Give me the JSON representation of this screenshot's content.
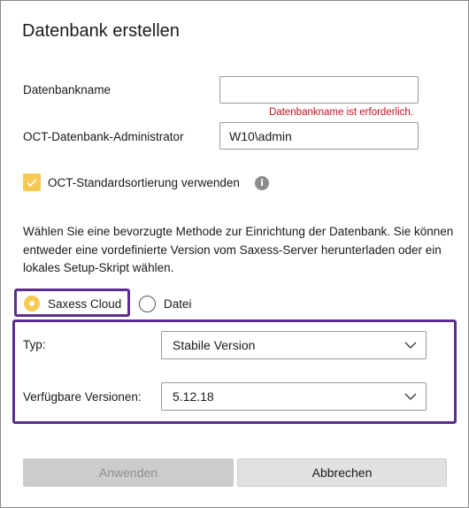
{
  "dialog": {
    "title": "Datenbank erstellen"
  },
  "form": {
    "db_name_label": "Datenbankname",
    "db_name_value": "",
    "db_name_error": "Datenbankname ist erforderlich.",
    "admin_label": "OCT-Datenbank-Administrator",
    "admin_value": "W10\\admin",
    "sort_checkbox_label": "OCT-Standardsortierung verwenden",
    "sort_checkbox_checked": true,
    "info_icon_glyph": "i"
  },
  "description": "Wählen Sie eine bevorzugte Methode zur Einrichtung der Datenbank. Sie können entweder eine vordefinierte Version vom Saxess-Server herunterladen oder ein lokales Setup-Skript wählen.",
  "method": {
    "options": [
      {
        "label": "Saxess Cloud",
        "selected": true
      },
      {
        "label": "Datei",
        "selected": false
      }
    ]
  },
  "cloud": {
    "type_label": "Typ:",
    "type_value": "Stabile Version",
    "versions_label": "Verfügbare Versionen:",
    "versions_value": "5.12.18"
  },
  "buttons": {
    "apply": "Anwenden",
    "cancel": "Abbrechen"
  },
  "colors": {
    "accent": "#f8c951",
    "highlight": "#5c2d91",
    "error": "#c50f1f"
  }
}
